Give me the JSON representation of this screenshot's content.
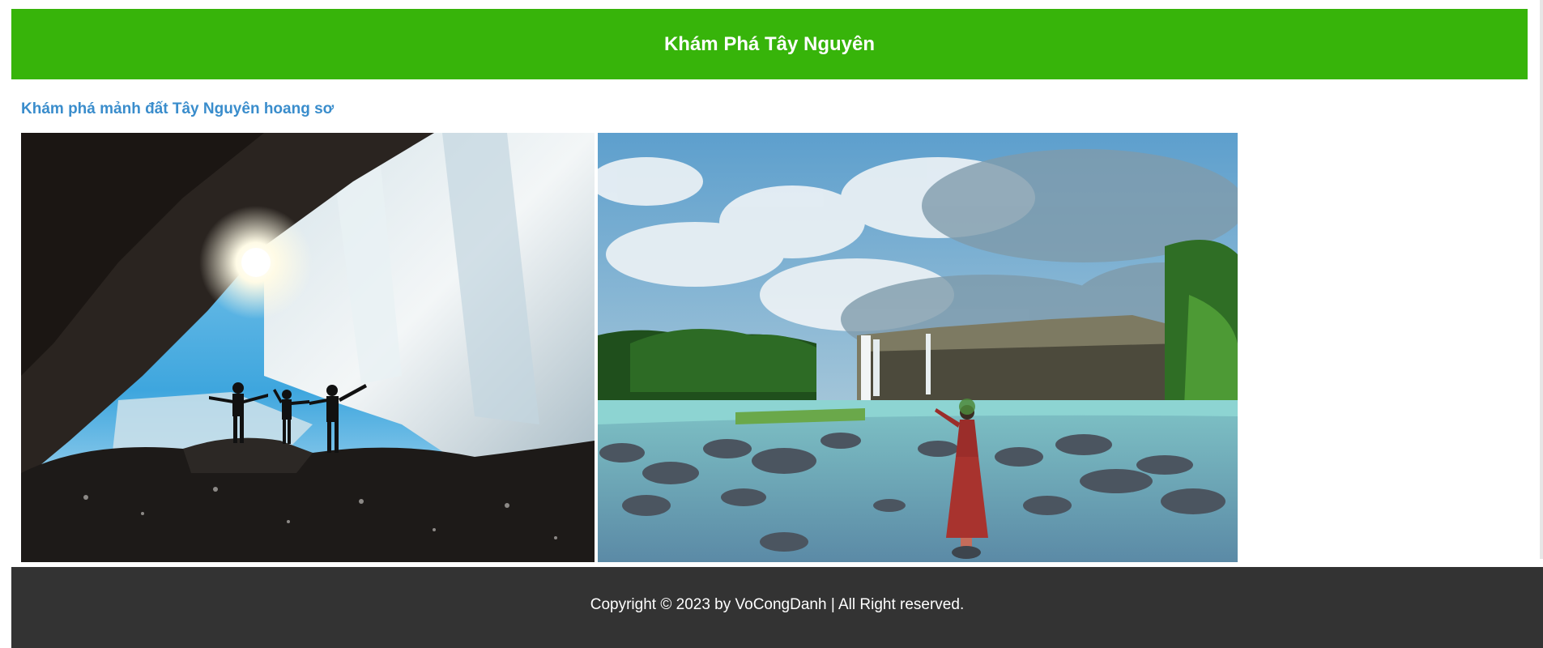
{
  "header": {
    "title": "Khám Phá Tây Nguyên",
    "background_color": "#37b40a"
  },
  "main": {
    "subtitle": "Khám phá mảnh đất Tây Nguyên hoang sơ",
    "subtitle_color": "#3a8dcc",
    "images": [
      {
        "name": "waterfall-cave-silhouettes-photo"
      },
      {
        "name": "river-waterfall-woman-photo"
      }
    ]
  },
  "footer": {
    "text": "Copyright © 2023 by VoCongDanh | All Right reserved.",
    "background_color": "#333333"
  }
}
